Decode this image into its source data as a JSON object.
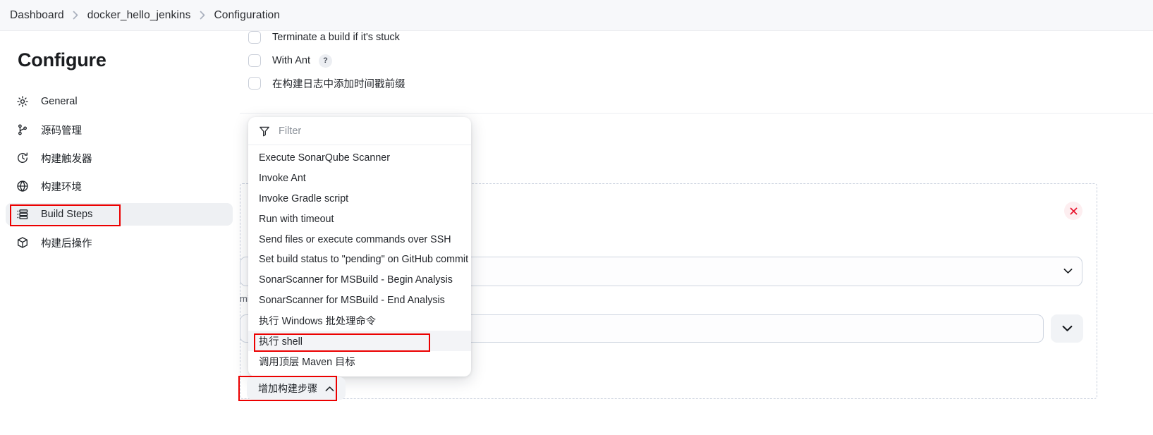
{
  "breadcrumb": {
    "items": [
      "Dashboard",
      "docker_hello_jenkins",
      "Configuration"
    ],
    "separator_icon": "chevron-right-icon"
  },
  "sidebar": {
    "title": "Configure",
    "items": [
      {
        "label": "General",
        "icon": "gear-icon",
        "active": false
      },
      {
        "label": "源码管理",
        "icon": "git-branch-icon",
        "active": false
      },
      {
        "label": "构建触发器",
        "icon": "clock-icon",
        "active": false
      },
      {
        "label": "构建环境",
        "icon": "globe-icon",
        "active": false
      },
      {
        "label": "Build Steps",
        "icon": "list-icon",
        "active": true
      },
      {
        "label": "构建后操作",
        "icon": "package-icon",
        "active": false
      }
    ]
  },
  "main": {
    "checkboxes": [
      {
        "label": "Terminate a build if it's stuck",
        "checked": false,
        "help": null
      },
      {
        "label": "With Ant",
        "checked": false,
        "help": "?"
      },
      {
        "label": "在构建日志中添加时间戳前缀",
        "checked": false,
        "help": null
      }
    ],
    "delete_button": {
      "icon": "close-icon",
      "color": "#e8152e"
    },
    "partial_label": "mit",
    "select_value": "",
    "combo_value": "",
    "chevron_icon": "chevron-down-icon"
  },
  "dropdown": {
    "filter": {
      "placeholder": "Filter",
      "value": "",
      "icon": "funnel-icon"
    },
    "items": [
      {
        "label": "Execute SonarQube Scanner",
        "hovered": false
      },
      {
        "label": "Invoke Ant",
        "hovered": false
      },
      {
        "label": "Invoke Gradle script",
        "hovered": false
      },
      {
        "label": "Run with timeout",
        "hovered": false
      },
      {
        "label": "Send files or execute commands over SSH",
        "hovered": false
      },
      {
        "label": "Set build status to \"pending\" on GitHub commit",
        "hovered": false
      },
      {
        "label": "SonarScanner for MSBuild - Begin Analysis",
        "hovered": false
      },
      {
        "label": "SonarScanner for MSBuild - End Analysis",
        "hovered": false
      },
      {
        "label": "执行 Windows 批处理命令",
        "hovered": false
      },
      {
        "label": "执行 shell",
        "hovered": true
      },
      {
        "label": "调用顶层 Maven 目标",
        "hovered": false
      }
    ]
  },
  "add_step_button": {
    "label": "增加构建步骤",
    "icon": "chevron-up-icon"
  },
  "annotations": {
    "color": "#ec0000",
    "count": 3
  }
}
